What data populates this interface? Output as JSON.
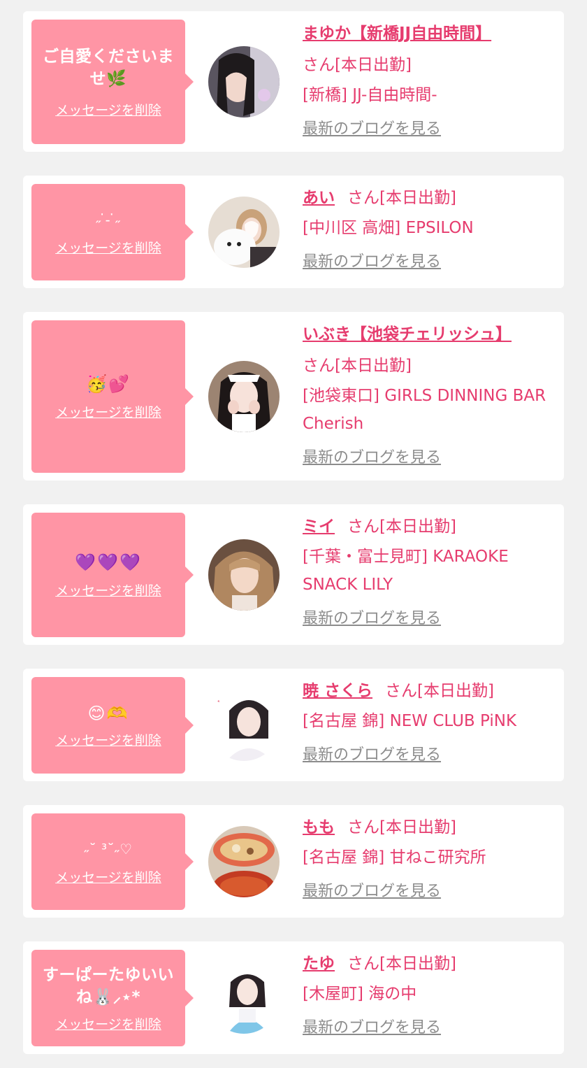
{
  "delete_label": "メッセージを削除",
  "blog_label": "最新のブログを見る",
  "colors": {
    "bubble": "#ff95a5",
    "accent_text": "#e63c6e",
    "link_gray": "#8c8c8c",
    "background": "#f1f1f1"
  },
  "cards": [
    {
      "message": "ご自愛くださいませ🌿",
      "name": "まゆか【新橋JJ自由時間】",
      "suffix": "さん[本日出勤]",
      "shop": "[新橋] JJ-自由時間-"
    },
    {
      "message": "˶ ̇ ̵ ̇˶",
      "name": "あい",
      "suffix": "さん[本日出勤]",
      "shop": "[中川区 高畑] EPSILON"
    },
    {
      "message": "🥳💕",
      "name": "いぶき【池袋チェリッシュ】",
      "suffix": "さん[本日出勤]",
      "shop": "[池袋東口] GIRLS DINNING BAR Cherish"
    },
    {
      "message": "💜💜💜",
      "name": "ミイ",
      "suffix": "さん[本日出勤]",
      "shop": "[千葉・富士見町] KARAOKE SNACK LILY"
    },
    {
      "message": "😊🫶",
      "name": "暁 さくら",
      "suffix": "さん[本日出勤]",
      "shop": "[名古屋 錦] NEW CLUB PiNK"
    },
    {
      "message": "˶˘ ³˘˶♡",
      "name": "もも",
      "suffix": "さん[本日出勤]",
      "shop": "[名古屋 錦] 甘ねこ研究所"
    },
    {
      "message": "すーぱーたゆいいね🐰⸝⋆*",
      "name": "たゆ",
      "suffix": "さん[本日出勤]",
      "shop": "[木屋町] 海の中"
    }
  ]
}
